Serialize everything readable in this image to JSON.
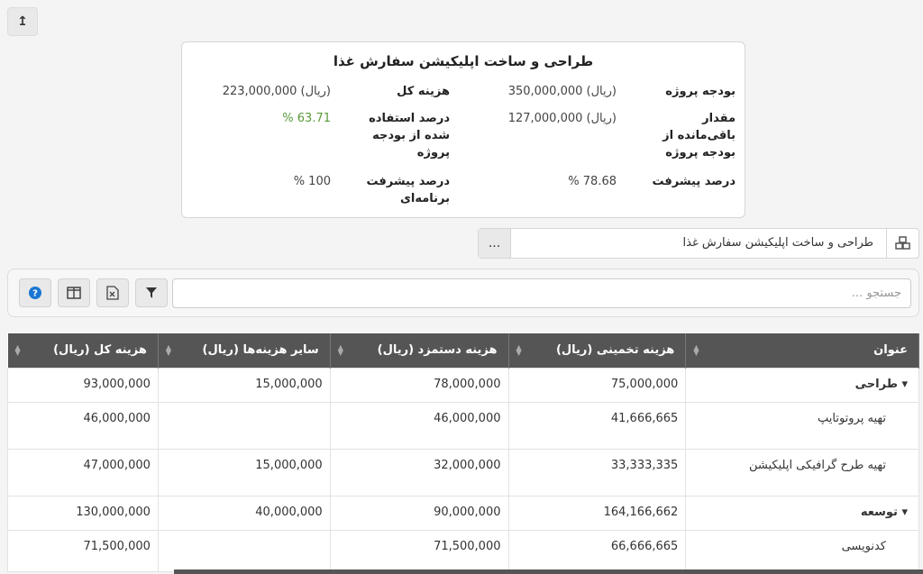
{
  "back_button": {
    "icon": "back-arrow-icon",
    "symbol": "↥"
  },
  "summary": {
    "title": "طراحی و ساخت اپلیکیشن سفارش غذا",
    "project_budget_label": "بودجه پروژه",
    "project_budget_value": "350,000,000 (ریال)",
    "total_cost_label": "هزینه کل",
    "total_cost_value": "223,000,000 (ریال)",
    "remaining_label": "مقدار باقی‌مانده از بودجه پروژه",
    "remaining_value": "127,000,000 (ریال)",
    "used_percent_label": "درصد استفاده شده از بودجه پروژه",
    "used_percent_value": "% 63.71",
    "progress_label": "درصد پیشرفت",
    "progress_value": "% 78.68",
    "planned_progress_label": "درصد پیشرفت برنامه‌ای",
    "planned_progress_value": "% 100"
  },
  "project_selector": {
    "value": "طراحی و ساخت اپلیکیشن سفارش غذا",
    "more_label": "...",
    "icon": "cubes-icon"
  },
  "toolbar": {
    "search_placeholder": "جستجو ...",
    "filter_icon": "filter-icon",
    "excel_icon": "excel-export-icon",
    "columns_icon": "columns-icon",
    "help_icon": "help-icon",
    "help_symbol": "?"
  },
  "colors": {
    "header_bg": "#555555",
    "accent_blue": "#1976d2",
    "green": "#5a9a3a"
  },
  "table": {
    "columns": [
      "عنوان",
      "هزینه تخمینی (ریال)",
      "هزینه دستمزد (ریال)",
      "سایر هزینه‌ها (ریال)",
      "هزینه کل (ریال)"
    ],
    "rows": [
      {
        "title": "طراحی",
        "group": true,
        "caret": "▾",
        "estimated": "75,000,000",
        "wage": "78,000,000",
        "other": "15,000,000",
        "total": "93,000,000"
      },
      {
        "title": "تهیه پروتوتایپ",
        "group": false,
        "caret": "",
        "estimated": "41,666,665",
        "wage": "46,000,000",
        "other": "",
        "total": "46,000,000"
      },
      {
        "title": "تهیه طرح گرافیکی اپلیکیشن",
        "group": false,
        "caret": "",
        "estimated": "33,333,335",
        "wage": "32,000,000",
        "other": "15,000,000",
        "total": "47,000,000"
      },
      {
        "title": "توسعه",
        "group": true,
        "caret": "▾",
        "estimated": "164,166,662",
        "wage": "90,000,000",
        "other": "40,000,000",
        "total": "130,000,000"
      },
      {
        "title": "کدنویسی",
        "group": false,
        "caret": "",
        "estimated": "66,666,665",
        "wage": "71,500,000",
        "other": "",
        "total": "71,500,000"
      }
    ]
  }
}
